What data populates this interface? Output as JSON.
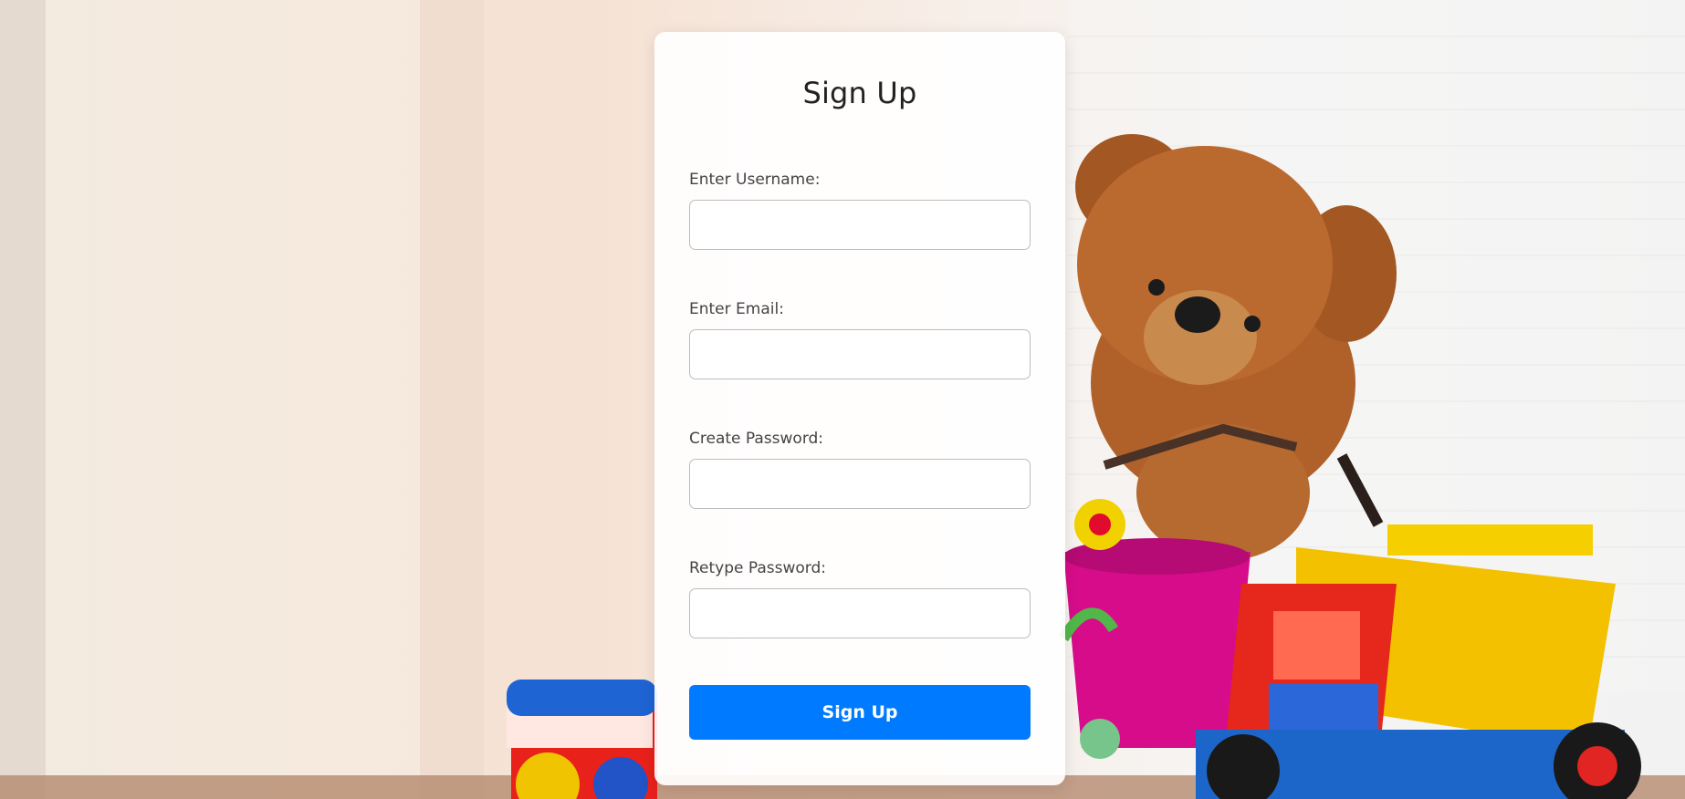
{
  "page": {
    "title": "Sign Up"
  },
  "form": {
    "fields": [
      {
        "label": "Enter Username:",
        "value": "",
        "placeholder": ""
      },
      {
        "label": "Enter Email:",
        "value": "",
        "placeholder": ""
      },
      {
        "label": "Create Password:",
        "value": "",
        "placeholder": ""
      },
      {
        "label": "Retype Password:",
        "value": "",
        "placeholder": ""
      }
    ],
    "submit_label": "Sign Up"
  },
  "colors": {
    "accent": "#007bff",
    "card": "#ffffff"
  },
  "background": {
    "icon": "toys-photo"
  }
}
